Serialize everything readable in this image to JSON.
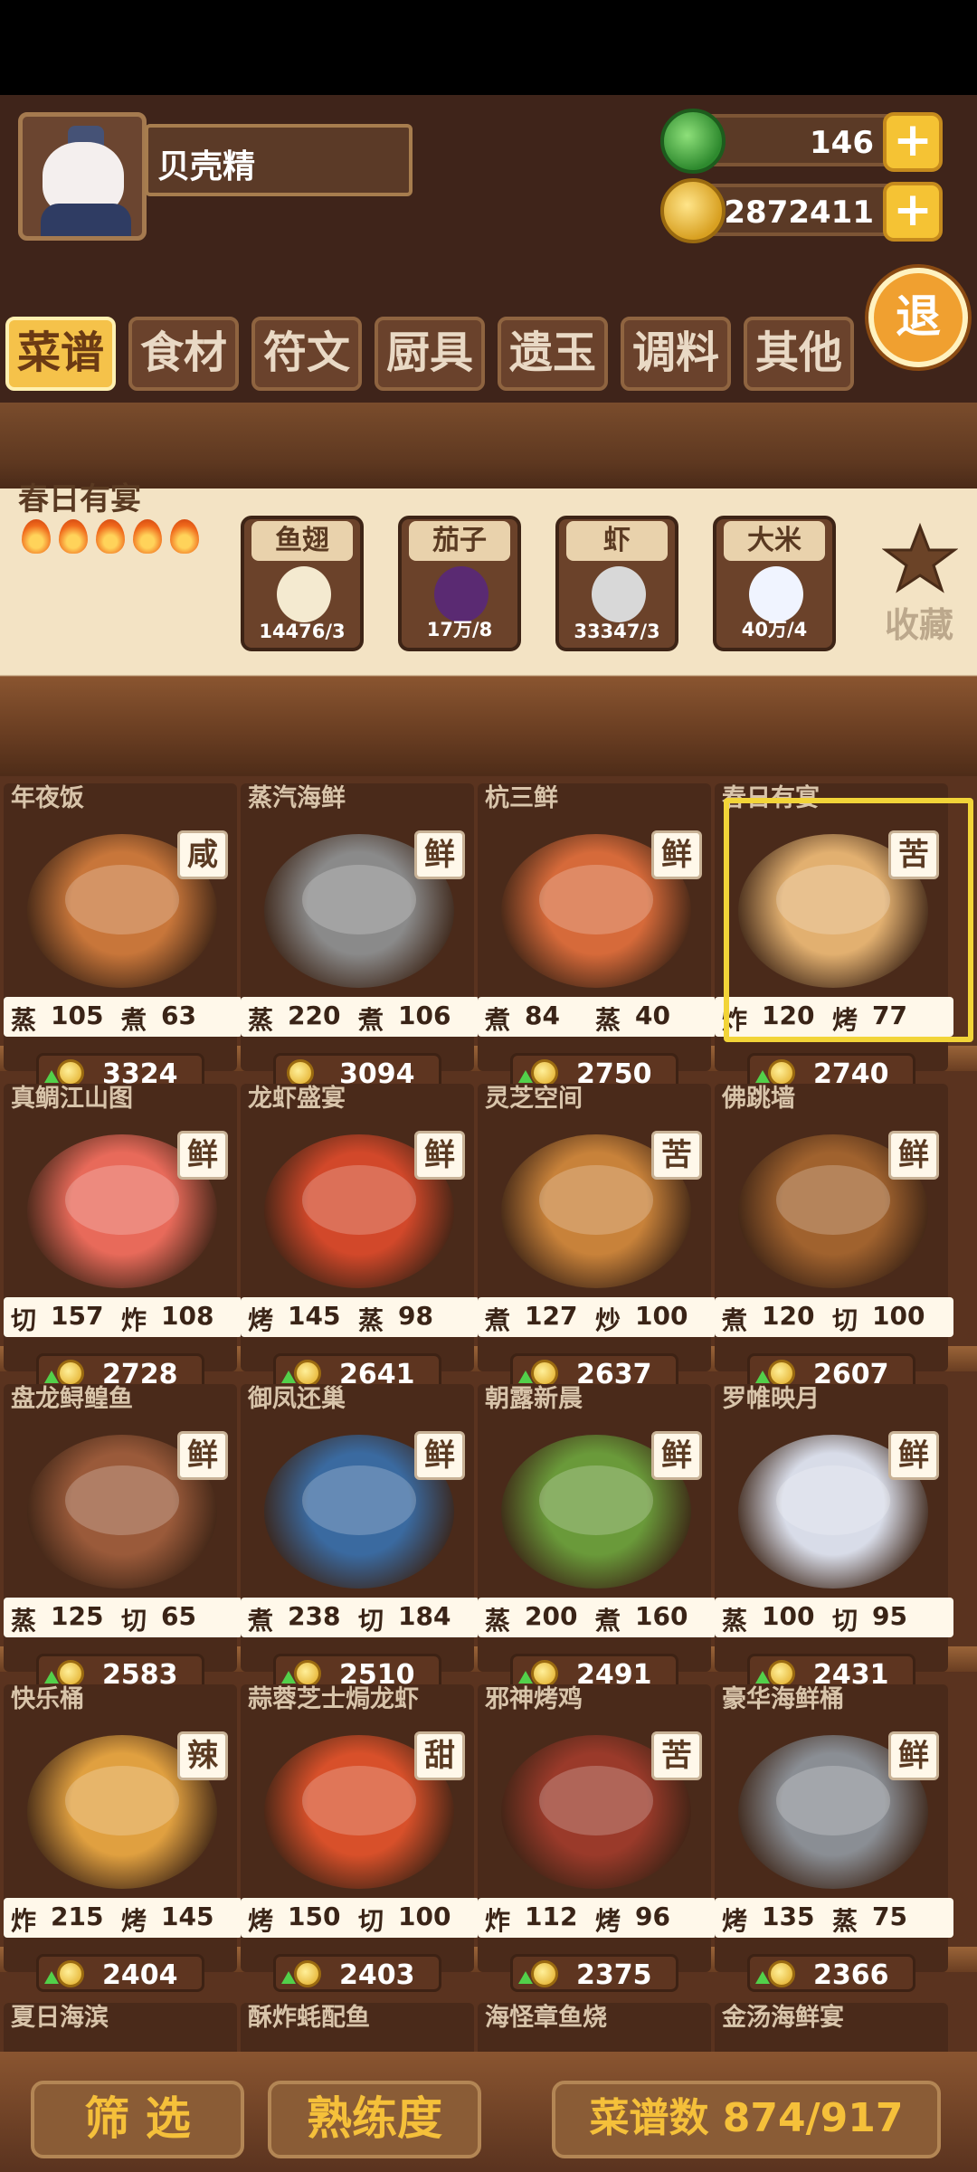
{
  "player": {
    "name": "贝壳精"
  },
  "currency": {
    "jade": "146",
    "coins": "2872411"
  },
  "exit_label": "退",
  "tabs": [
    "菜谱",
    "食材",
    "符文",
    "厨具",
    "遗玉",
    "调料",
    "其他"
  ],
  "selected_recipe": {
    "name": "春日有宴",
    "flames": 5,
    "ingredients": [
      {
        "name": "鱼翅",
        "qty": "14476/3",
        "icon": "shark-fin-icon"
      },
      {
        "name": "茄子",
        "qty": "17万/8",
        "icon": "eggplant-icon"
      },
      {
        "name": "虾",
        "qty": "33347/3",
        "icon": "shrimp-icon"
      },
      {
        "name": "大米",
        "qty": "40万/4",
        "icon": "rice-icon"
      }
    ],
    "favorite_label": "收藏"
  },
  "recipes": [
    {
      "name": "年夜饭",
      "flavor": "咸",
      "s1": "蒸",
      "v1": "105",
      "s2": "煮",
      "v2": "63",
      "price": "3324",
      "up": true,
      "color": "#c8763a"
    },
    {
      "name": "蒸汽海鲜",
      "flavor": "鲜",
      "s1": "蒸",
      "v1": "220",
      "s2": "煮",
      "v2": "106",
      "price": "3094",
      "up": false,
      "color": "#8a8a8a"
    },
    {
      "name": "杭三鲜",
      "flavor": "鲜",
      "s1": "煮",
      "v1": "84",
      "s2": "蒸",
      "v2": "40",
      "price": "2750",
      "up": true,
      "color": "#d66a3a"
    },
    {
      "name": "春日有宴",
      "flavor": "苦",
      "s1": "炸",
      "v1": "120",
      "s2": "烤",
      "v2": "77",
      "price": "2740",
      "up": true,
      "color": "#e2b070"
    },
    {
      "name": "真鲷江山图",
      "flavor": "鲜",
      "s1": "切",
      "v1": "157",
      "s2": "炸",
      "v2": "108",
      "price": "2728",
      "up": true,
      "color": "#e86a5a"
    },
    {
      "name": "龙虾盛宴",
      "flavor": "鲜",
      "s1": "烤",
      "v1": "145",
      "s2": "蒸",
      "v2": "98",
      "price": "2641",
      "up": true,
      "color": "#d2482a"
    },
    {
      "name": "灵芝空间",
      "flavor": "苦",
      "s1": "煮",
      "v1": "127",
      "s2": "炒",
      "v2": "100",
      "price": "2637",
      "up": true,
      "color": "#c8823a"
    },
    {
      "name": "佛跳墙",
      "flavor": "鲜",
      "s1": "煮",
      "v1": "120",
      "s2": "切",
      "v2": "100",
      "price": "2607",
      "up": true,
      "color": "#a0622e"
    },
    {
      "name": "盘龙鲟鳇鱼",
      "flavor": "鲜",
      "s1": "蒸",
      "v1": "125",
      "s2": "切",
      "v2": "65",
      "price": "2583",
      "up": true,
      "color": "#9a5a3a"
    },
    {
      "name": "御凤还巢",
      "flavor": "鲜",
      "s1": "煮",
      "v1": "238",
      "s2": "切",
      "v2": "184",
      "price": "2510",
      "up": true,
      "color": "#3a6aa0"
    },
    {
      "name": "朝露新晨",
      "flavor": "鲜",
      "s1": "蒸",
      "v1": "200",
      "s2": "煮",
      "v2": "160",
      "price": "2491",
      "up": true,
      "color": "#6a9a3a"
    },
    {
      "name": "罗帷映月",
      "flavor": "鲜",
      "s1": "蒸",
      "v1": "100",
      "s2": "切",
      "v2": "95",
      "price": "2431",
      "up": true,
      "color": "#d8dce8"
    },
    {
      "name": "快乐桶",
      "flavor": "辣",
      "s1": "炸",
      "v1": "215",
      "s2": "烤",
      "v2": "145",
      "price": "2404",
      "up": true,
      "color": "#e0a040"
    },
    {
      "name": "蒜蓉芝士焗龙虾",
      "flavor": "甜",
      "s1": "烤",
      "v1": "150",
      "s2": "切",
      "v2": "100",
      "price": "2403",
      "up": true,
      "color": "#d8502a"
    },
    {
      "name": "邪神烤鸡",
      "flavor": "苦",
      "s1": "炸",
      "v1": "112",
      "s2": "烤",
      "v2": "96",
      "price": "2375",
      "up": true,
      "color": "#9a3a2a"
    },
    {
      "name": "豪华海鲜桶",
      "flavor": "鲜",
      "s1": "烤",
      "v1": "135",
      "s2": "蒸",
      "v2": "75",
      "price": "2366",
      "up": true,
      "color": "#8a8e94"
    }
  ],
  "partial_recipes": [
    "夏日海滨",
    "酥炸蚝配鱼",
    "海怪章鱼烧",
    "金汤海鲜宴"
  ],
  "bottom": {
    "filter": "筛 选",
    "proficiency": "熟练度",
    "count": "菜谱数 874/917"
  }
}
